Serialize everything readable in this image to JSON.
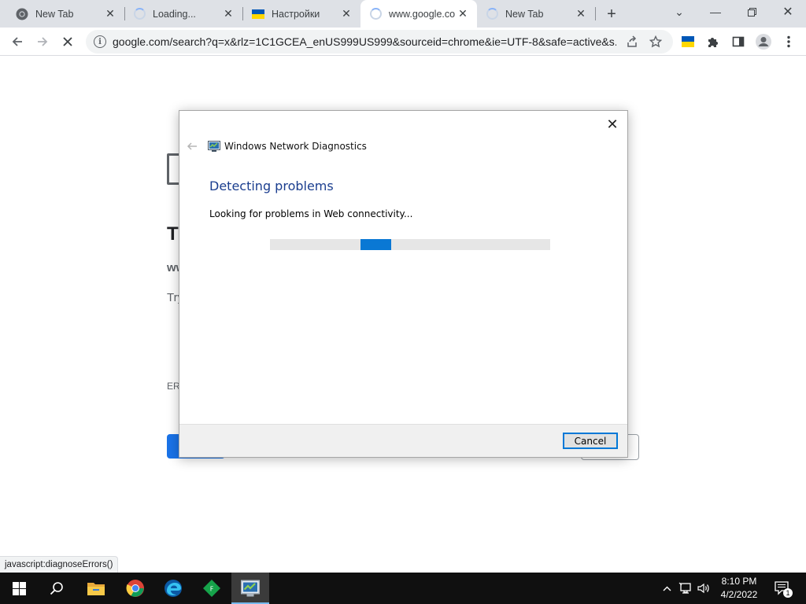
{
  "browser": {
    "tabs": [
      {
        "title": "New Tab",
        "favicon": "chrome-icon",
        "active": false
      },
      {
        "title": "Loading...",
        "favicon": "loading-spinner-icon",
        "active": false
      },
      {
        "title": "Настройки",
        "favicon": "ukraine-flag-icon",
        "active": false
      },
      {
        "title": "www.google.co",
        "favicon": "loading-spinner-icon",
        "active": true
      },
      {
        "title": "New Tab",
        "favicon": "loading-spinner-icon",
        "active": false
      }
    ],
    "url": "google.com/search?q=x&rlz=1C1GCEA_enUS999US999&sourceid=chrome&ie=UTF-8&safe=active&s...",
    "status_bubble": "javascript:diagnoseErrors()"
  },
  "error_page": {
    "title_partial": "T",
    "host_partial": "ww",
    "try_partial": "Try",
    "code_partial": "ERR"
  },
  "dialog": {
    "app_title": "Windows Network Diagnostics",
    "heading": "Detecting problems",
    "status": "Looking for problems in Web connectivity...",
    "cancel_label": "Cancel",
    "progress": "indeterminate"
  },
  "taskbar": {
    "apps": [
      "start-icon",
      "search-icon",
      "file-explorer-icon",
      "chrome-icon",
      "edge-icon",
      "feedback-app-icon",
      "network-diagnostics-icon"
    ],
    "time": "8:10 PM",
    "date": "4/2/2022",
    "notification_count": "1"
  },
  "colors": {
    "accent_blue": "#0a78d4",
    "heading_blue": "#1b3e8f",
    "tab_strip": "#dee1e6",
    "taskbar": "#101010"
  }
}
